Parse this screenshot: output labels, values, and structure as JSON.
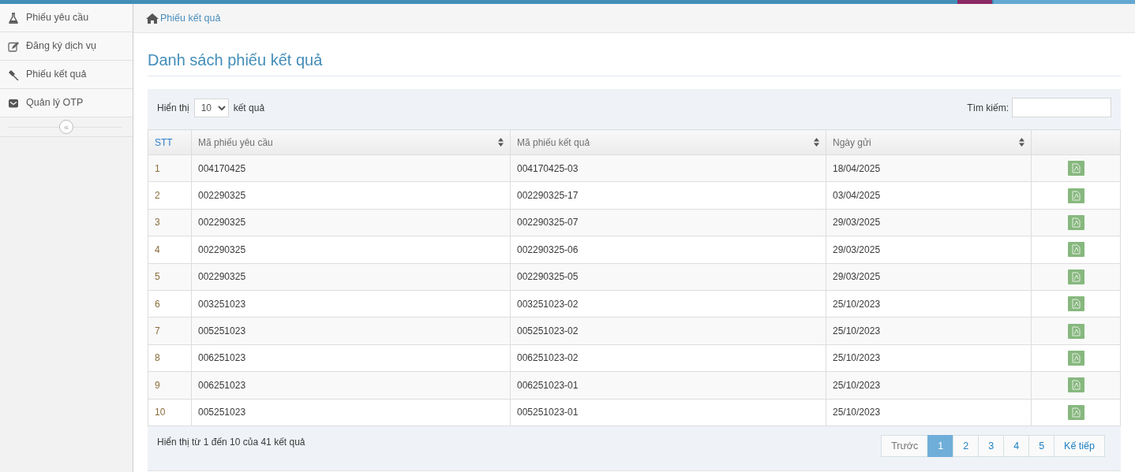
{
  "sidebar": {
    "items": [
      {
        "label": "Phiếu yêu cầu"
      },
      {
        "label": "Đăng ký dịch vụ"
      },
      {
        "label": "Phiếu kết quả"
      },
      {
        "label": "Quản lý OTP"
      }
    ],
    "collapse_button": {
      "label": "«"
    }
  },
  "breadcrumb": {
    "label": "Phiếu kết quả"
  },
  "page_title": "Danh sách phiếu kết quả",
  "length_menu": {
    "prefix": "Hiển thị",
    "value": "10",
    "suffix": "kết quả"
  },
  "search": {
    "label": "Tìm kiếm:"
  },
  "table": {
    "columns": [
      {
        "label": "STT",
        "sortable": false
      },
      {
        "label": "Mã phiếu yêu cầu",
        "sortable": true
      },
      {
        "label": "Mã phiếu kết quả",
        "sortable": true
      },
      {
        "label": "Ngày gửi",
        "sortable": true
      }
    ],
    "rows": [
      [
        "1",
        "004170425",
        "004170425-03",
        "18/04/2025"
      ],
      [
        "2",
        "002290325",
        "002290325-17",
        "03/04/2025"
      ],
      [
        "3",
        "002290325",
        "002290325-07",
        "29/03/2025"
      ],
      [
        "4",
        "002290325",
        "002290325-06",
        "29/03/2025"
      ],
      [
        "5",
        "002290325",
        "002290325-05",
        "29/03/2025"
      ],
      [
        "6",
        "003251023",
        "003251023-02",
        "25/10/2023"
      ],
      [
        "7",
        "005251023",
        "005251023-02",
        "25/10/2023"
      ],
      [
        "8",
        "006251023",
        "006251023-02",
        "25/10/2023"
      ],
      [
        "9",
        "006251023",
        "006251023-01",
        "25/10/2023"
      ],
      [
        "10",
        "005251023",
        "005251023-01",
        "25/10/2023"
      ]
    ]
  },
  "info": "Hiển thị từ 1 đến 10 của 41 kết quả",
  "pagination": [
    {
      "label": "Trước",
      "selected": false,
      "disabled": true
    },
    {
      "label": "1",
      "selected": true,
      "disabled": false
    },
    {
      "label": "2",
      "selected": false,
      "disabled": false
    },
    {
      "label": "3",
      "selected": false,
      "disabled": false
    },
    {
      "label": "4",
      "selected": false,
      "disabled": false
    },
    {
      "label": "5",
      "selected": false,
      "disabled": false
    },
    {
      "label": "Kế tiếp",
      "selected": false,
      "disabled": false
    }
  ]
}
